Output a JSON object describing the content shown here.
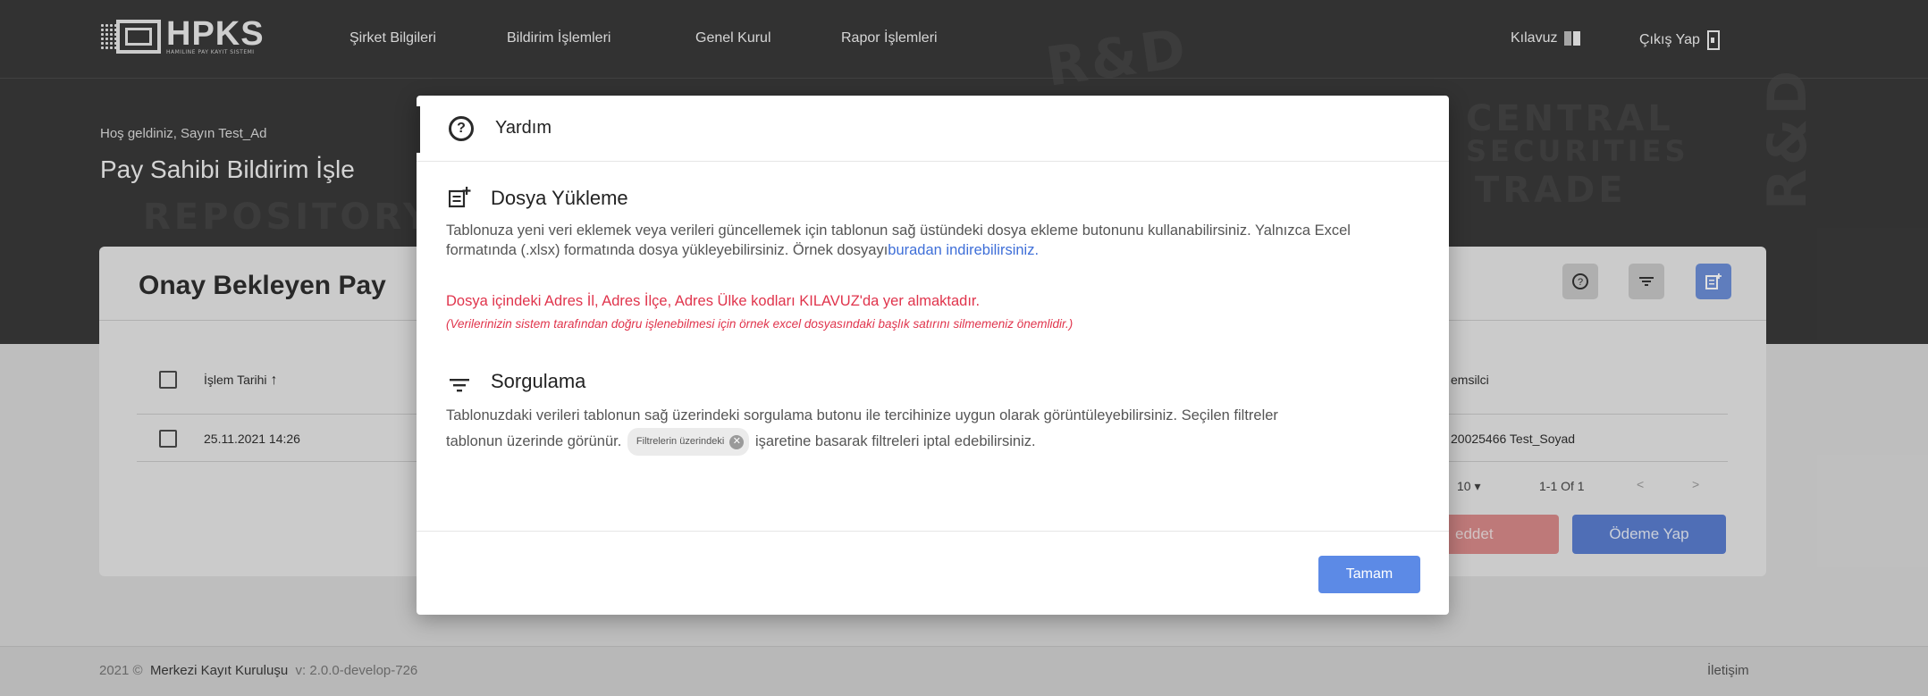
{
  "header": {
    "logo_text": "HPKS",
    "logo_subtext": "HAMILINE PAY KAYIT SISTEMI",
    "nav": [
      "Şirket Bilgileri",
      "Bildirim İşlemleri",
      "Genel Kurul",
      "Rapor İşlemleri"
    ],
    "guide_label": "Kılavuz",
    "logout_label": "Çıkış Yap",
    "welcome": "Hoş geldiniz, Sayın Test_Ad",
    "page_title": "Pay Sahibi Bildirim İşle"
  },
  "card": {
    "title": "Onay Bekleyen Pay",
    "columns": [
      "İşlem Tarihi",
      "emsilci"
    ],
    "rows": [
      {
        "date": "25.11.2021 14:26",
        "rep": "20025466 Test_Soyad"
      }
    ],
    "pagination": {
      "per_page": "10",
      "range": "1-1 Of 1",
      "prev": "<",
      "next": ">"
    },
    "reject_label": "eddet",
    "pay_label": "Ödeme Yap"
  },
  "footer": {
    "year": "2021 ©",
    "org": "Merkezi Kayıt Kuruluşu",
    "version": "v: 2.0.0-develop-726",
    "contact": "İletişim"
  },
  "modal": {
    "title": "Yardım",
    "upload": {
      "title": "Dosya Yükleme",
      "text_1": "Tablonuza yeni veri eklemek veya verileri güncellemek için tablonun sağ üstündeki dosya ekleme butonunu kullanabilirsiniz. Yalnızca Excel formatında (.xlsx) formatında dosya yükleyebilirsiniz. Örnek dosyayı",
      "link": "buradan indirebilirsiniz.",
      "red_note": "Dosya içindeki Adres İl, Adres İlçe, Adres Ülke kodları KILAVUZ'da yer almaktadır.",
      "italic_note": "(Verilerinizin sistem tarafından doğru işlenebilmesi için örnek excel dosyasındaki başlık satırını silmemeniz önemlidir.)"
    },
    "query": {
      "title": "Sorgulama",
      "text_1": "Tablonuzdaki verileri tablonun sağ üzerindeki sorgulama butonu ile tercihinize uygun olarak görüntüleyebilirsiniz. Seçilen filtreler tablonun üzerinde görünür.",
      "chip": "Filtrelerin üzerindeki",
      "text_2": "işaretine basarak filtreleri iptal edebilirsiniz."
    },
    "ok_label": "Tamam"
  },
  "colors": {
    "header_bg": "#3a3a3a",
    "accent_blue": "#5c8ae6",
    "error_red": "#e0344c"
  }
}
